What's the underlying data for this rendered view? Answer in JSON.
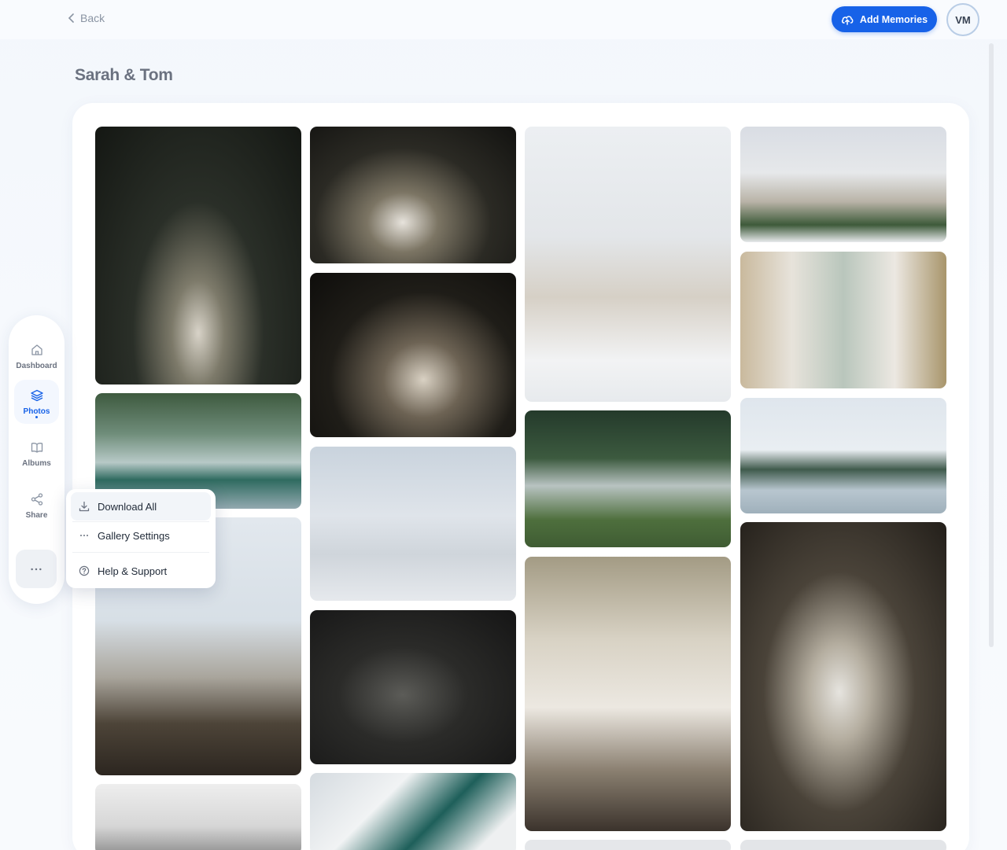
{
  "header": {
    "back_label": "Back",
    "add_memories_label": "Add Memories",
    "avatar_initials": "VM",
    "accent": "#1762e8"
  },
  "gallery": {
    "title": "Sarah & Tom"
  },
  "sidebar": {
    "items": [
      {
        "label": "Dashboard",
        "icon": "home-icon",
        "active": false
      },
      {
        "label": "Photos",
        "icon": "layers-icon",
        "active": true
      },
      {
        "label": "Albums",
        "icon": "book-icon",
        "active": false
      },
      {
        "label": "Share",
        "icon": "share-icon",
        "active": false
      }
    ],
    "more_icon": "more-icon"
  },
  "menu": {
    "items": [
      {
        "label": "Download All",
        "icon": "download-icon"
      },
      {
        "label": "Gallery Settings",
        "icon": "ellipsis-icon"
      },
      {
        "label": "Help & Support",
        "icon": "help-icon"
      }
    ]
  }
}
